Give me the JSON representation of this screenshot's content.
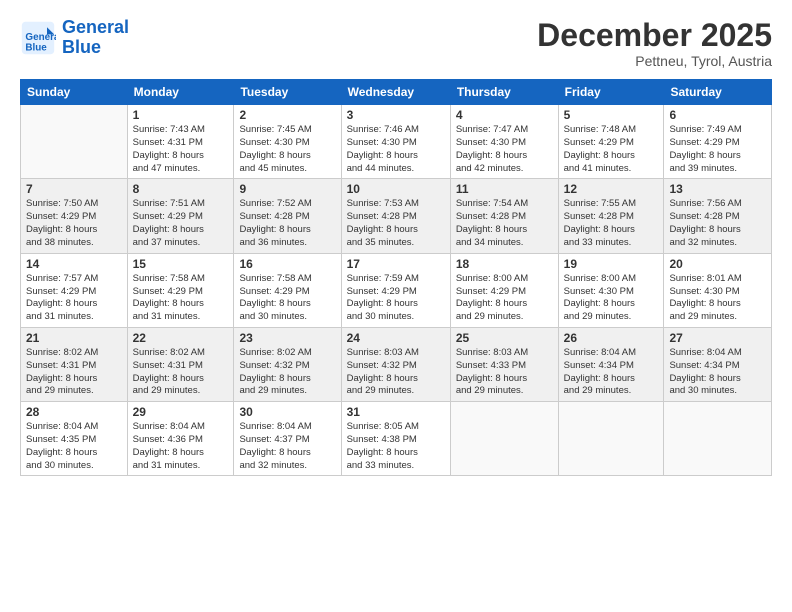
{
  "header": {
    "logo_line1": "General",
    "logo_line2": "Blue",
    "month": "December 2025",
    "location": "Pettneu, Tyrol, Austria"
  },
  "weekdays": [
    "Sunday",
    "Monday",
    "Tuesday",
    "Wednesday",
    "Thursday",
    "Friday",
    "Saturday"
  ],
  "weeks": [
    [
      {
        "day": "",
        "info": ""
      },
      {
        "day": "1",
        "info": "Sunrise: 7:43 AM\nSunset: 4:31 PM\nDaylight: 8 hours\nand 47 minutes."
      },
      {
        "day": "2",
        "info": "Sunrise: 7:45 AM\nSunset: 4:30 PM\nDaylight: 8 hours\nand 45 minutes."
      },
      {
        "day": "3",
        "info": "Sunrise: 7:46 AM\nSunset: 4:30 PM\nDaylight: 8 hours\nand 44 minutes."
      },
      {
        "day": "4",
        "info": "Sunrise: 7:47 AM\nSunset: 4:30 PM\nDaylight: 8 hours\nand 42 minutes."
      },
      {
        "day": "5",
        "info": "Sunrise: 7:48 AM\nSunset: 4:29 PM\nDaylight: 8 hours\nand 41 minutes."
      },
      {
        "day": "6",
        "info": "Sunrise: 7:49 AM\nSunset: 4:29 PM\nDaylight: 8 hours\nand 39 minutes."
      }
    ],
    [
      {
        "day": "7",
        "info": "Sunrise: 7:50 AM\nSunset: 4:29 PM\nDaylight: 8 hours\nand 38 minutes."
      },
      {
        "day": "8",
        "info": "Sunrise: 7:51 AM\nSunset: 4:29 PM\nDaylight: 8 hours\nand 37 minutes."
      },
      {
        "day": "9",
        "info": "Sunrise: 7:52 AM\nSunset: 4:28 PM\nDaylight: 8 hours\nand 36 minutes."
      },
      {
        "day": "10",
        "info": "Sunrise: 7:53 AM\nSunset: 4:28 PM\nDaylight: 8 hours\nand 35 minutes."
      },
      {
        "day": "11",
        "info": "Sunrise: 7:54 AM\nSunset: 4:28 PM\nDaylight: 8 hours\nand 34 minutes."
      },
      {
        "day": "12",
        "info": "Sunrise: 7:55 AM\nSunset: 4:28 PM\nDaylight: 8 hours\nand 33 minutes."
      },
      {
        "day": "13",
        "info": "Sunrise: 7:56 AM\nSunset: 4:28 PM\nDaylight: 8 hours\nand 32 minutes."
      }
    ],
    [
      {
        "day": "14",
        "info": "Sunrise: 7:57 AM\nSunset: 4:29 PM\nDaylight: 8 hours\nand 31 minutes."
      },
      {
        "day": "15",
        "info": "Sunrise: 7:58 AM\nSunset: 4:29 PM\nDaylight: 8 hours\nand 31 minutes."
      },
      {
        "day": "16",
        "info": "Sunrise: 7:58 AM\nSunset: 4:29 PM\nDaylight: 8 hours\nand 30 minutes."
      },
      {
        "day": "17",
        "info": "Sunrise: 7:59 AM\nSunset: 4:29 PM\nDaylight: 8 hours\nand 30 minutes."
      },
      {
        "day": "18",
        "info": "Sunrise: 8:00 AM\nSunset: 4:29 PM\nDaylight: 8 hours\nand 29 minutes."
      },
      {
        "day": "19",
        "info": "Sunrise: 8:00 AM\nSunset: 4:30 PM\nDaylight: 8 hours\nand 29 minutes."
      },
      {
        "day": "20",
        "info": "Sunrise: 8:01 AM\nSunset: 4:30 PM\nDaylight: 8 hours\nand 29 minutes."
      }
    ],
    [
      {
        "day": "21",
        "info": "Sunrise: 8:02 AM\nSunset: 4:31 PM\nDaylight: 8 hours\nand 29 minutes."
      },
      {
        "day": "22",
        "info": "Sunrise: 8:02 AM\nSunset: 4:31 PM\nDaylight: 8 hours\nand 29 minutes."
      },
      {
        "day": "23",
        "info": "Sunrise: 8:02 AM\nSunset: 4:32 PM\nDaylight: 8 hours\nand 29 minutes."
      },
      {
        "day": "24",
        "info": "Sunrise: 8:03 AM\nSunset: 4:32 PM\nDaylight: 8 hours\nand 29 minutes."
      },
      {
        "day": "25",
        "info": "Sunrise: 8:03 AM\nSunset: 4:33 PM\nDaylight: 8 hours\nand 29 minutes."
      },
      {
        "day": "26",
        "info": "Sunrise: 8:04 AM\nSunset: 4:34 PM\nDaylight: 8 hours\nand 29 minutes."
      },
      {
        "day": "27",
        "info": "Sunrise: 8:04 AM\nSunset: 4:34 PM\nDaylight: 8 hours\nand 30 minutes."
      }
    ],
    [
      {
        "day": "28",
        "info": "Sunrise: 8:04 AM\nSunset: 4:35 PM\nDaylight: 8 hours\nand 30 minutes."
      },
      {
        "day": "29",
        "info": "Sunrise: 8:04 AM\nSunset: 4:36 PM\nDaylight: 8 hours\nand 31 minutes."
      },
      {
        "day": "30",
        "info": "Sunrise: 8:04 AM\nSunset: 4:37 PM\nDaylight: 8 hours\nand 32 minutes."
      },
      {
        "day": "31",
        "info": "Sunrise: 8:05 AM\nSunset: 4:38 PM\nDaylight: 8 hours\nand 33 minutes."
      },
      {
        "day": "",
        "info": ""
      },
      {
        "day": "",
        "info": ""
      },
      {
        "day": "",
        "info": ""
      }
    ]
  ]
}
